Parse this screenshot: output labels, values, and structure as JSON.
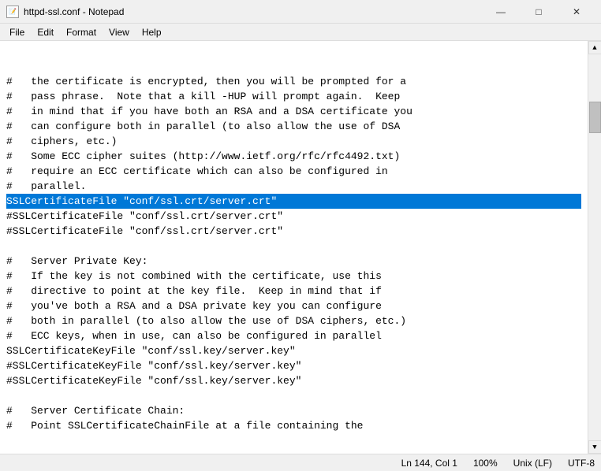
{
  "titleBar": {
    "title": "httpd-ssl.conf - Notepad",
    "icon": "📄",
    "controls": {
      "minimize": "—",
      "maximize": "□",
      "close": "✕"
    }
  },
  "menuBar": {
    "items": [
      "File",
      "Edit",
      "Format",
      "View",
      "Help"
    ]
  },
  "editor": {
    "lines": [
      {
        "id": 1,
        "text": "#   the certificate is encrypted, then you will be prompted for a",
        "selected": false
      },
      {
        "id": 2,
        "text": "#   pass phrase.  Note that a kill -HUP will prompt again.  Keep",
        "selected": false
      },
      {
        "id": 3,
        "text": "#   in mind that if you have both an RSA and a DSA certificate you",
        "selected": false
      },
      {
        "id": 4,
        "text": "#   can configure both in parallel (to also allow the use of DSA",
        "selected": false
      },
      {
        "id": 5,
        "text": "#   ciphers, etc.)",
        "selected": false
      },
      {
        "id": 6,
        "text": "#   Some ECC cipher suites (http://www.ietf.org/rfc/rfc4492.txt)",
        "selected": false
      },
      {
        "id": 7,
        "text": "#   require an ECC certificate which can also be configured in",
        "selected": false
      },
      {
        "id": 8,
        "text": "#   parallel.",
        "selected": false
      },
      {
        "id": 9,
        "text": "SSLCertificateFile \"conf/ssl.crt/server.crt\"",
        "selected": true
      },
      {
        "id": 10,
        "text": "#SSLCertificateFile \"conf/ssl.crt/server.crt\"",
        "selected": false
      },
      {
        "id": 11,
        "text": "#SSLCertificateFile \"conf/ssl.crt/server.crt\"",
        "selected": false
      },
      {
        "id": 12,
        "text": "",
        "selected": false
      },
      {
        "id": 13,
        "text": "#   Server Private Key:",
        "selected": false
      },
      {
        "id": 14,
        "text": "#   If the key is not combined with the certificate, use this",
        "selected": false
      },
      {
        "id": 15,
        "text": "#   directive to point at the key file.  Keep in mind that if",
        "selected": false
      },
      {
        "id": 16,
        "text": "#   you've both a RSA and a DSA private key you can configure",
        "selected": false
      },
      {
        "id": 17,
        "text": "#   both in parallel (to also allow the use of DSA ciphers, etc.)",
        "selected": false
      },
      {
        "id": 18,
        "text": "#   ECC keys, when in use, can also be configured in parallel",
        "selected": false
      },
      {
        "id": 19,
        "text": "SSLCertificateKeyFile \"conf/ssl.key/server.key\"",
        "selected": false
      },
      {
        "id": 20,
        "text": "#SSLCertificateKeyFile \"conf/ssl.key/server.key\"",
        "selected": false
      },
      {
        "id": 21,
        "text": "#SSLCertificateKeyFile \"conf/ssl.key/server.key\"",
        "selected": false
      },
      {
        "id": 22,
        "text": "",
        "selected": false
      },
      {
        "id": 23,
        "text": "#   Server Certificate Chain:",
        "selected": false
      },
      {
        "id": 24,
        "text": "#   Point SSLCertificateChainFile at a file containing the",
        "selected": false
      }
    ]
  },
  "statusBar": {
    "position": "Ln 144, Col 1",
    "zoom": "100%",
    "lineEnding": "Unix (LF)",
    "encoding": "UTF-8"
  }
}
